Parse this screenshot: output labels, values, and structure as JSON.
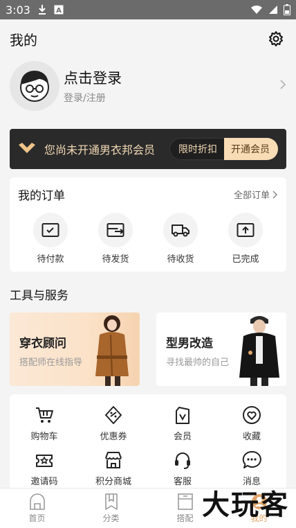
{
  "status_bar": {
    "time": "3:03"
  },
  "header": {
    "title": "我的"
  },
  "profile": {
    "title": "点击登录",
    "subtitle": "登录/注册"
  },
  "vip": {
    "text": "您尚未开通男衣邦会员",
    "tag_left": "限时折扣",
    "tag_right": "开通会员"
  },
  "orders": {
    "title": "我的订单",
    "more": "全部订单",
    "items": [
      {
        "label": "待付款",
        "icon": "wallet-icon"
      },
      {
        "label": "待发货",
        "icon": "box-icon"
      },
      {
        "label": "待收货",
        "icon": "truck-icon"
      },
      {
        "label": "已完成",
        "icon": "done-box-icon"
      }
    ]
  },
  "tools_section": {
    "title": "工具与服务"
  },
  "promos": [
    {
      "title": "穿衣顾问",
      "subtitle": "搭配师在线指导"
    },
    {
      "title": "型男改造",
      "subtitle": "寻找最帅的自己"
    }
  ],
  "tools": [
    {
      "label": "购物车",
      "icon": "cart-icon"
    },
    {
      "label": "优惠券",
      "icon": "coupon-icon"
    },
    {
      "label": "会员",
      "icon": "vip-icon"
    },
    {
      "label": "收藏",
      "icon": "favorite-icon"
    },
    {
      "label": "邀请码",
      "icon": "invite-icon"
    },
    {
      "label": "积分商城",
      "icon": "shop-icon"
    },
    {
      "label": "客服",
      "icon": "headset-icon"
    },
    {
      "label": "消息",
      "icon": "message-icon"
    }
  ],
  "tabbar": [
    {
      "label": "首页",
      "icon": "home-icon"
    },
    {
      "label": "分类",
      "icon": "bookmark-icon"
    },
    {
      "label": "搭配",
      "icon": "wardrobe-icon"
    },
    {
      "label": "我的",
      "icon": "profile-icon"
    }
  ],
  "watermark": "大玩客",
  "colors": {
    "accent": "#e0a46a",
    "vip_bg": "#2a2a2a",
    "vip_gold": "#f1d8b4"
  }
}
